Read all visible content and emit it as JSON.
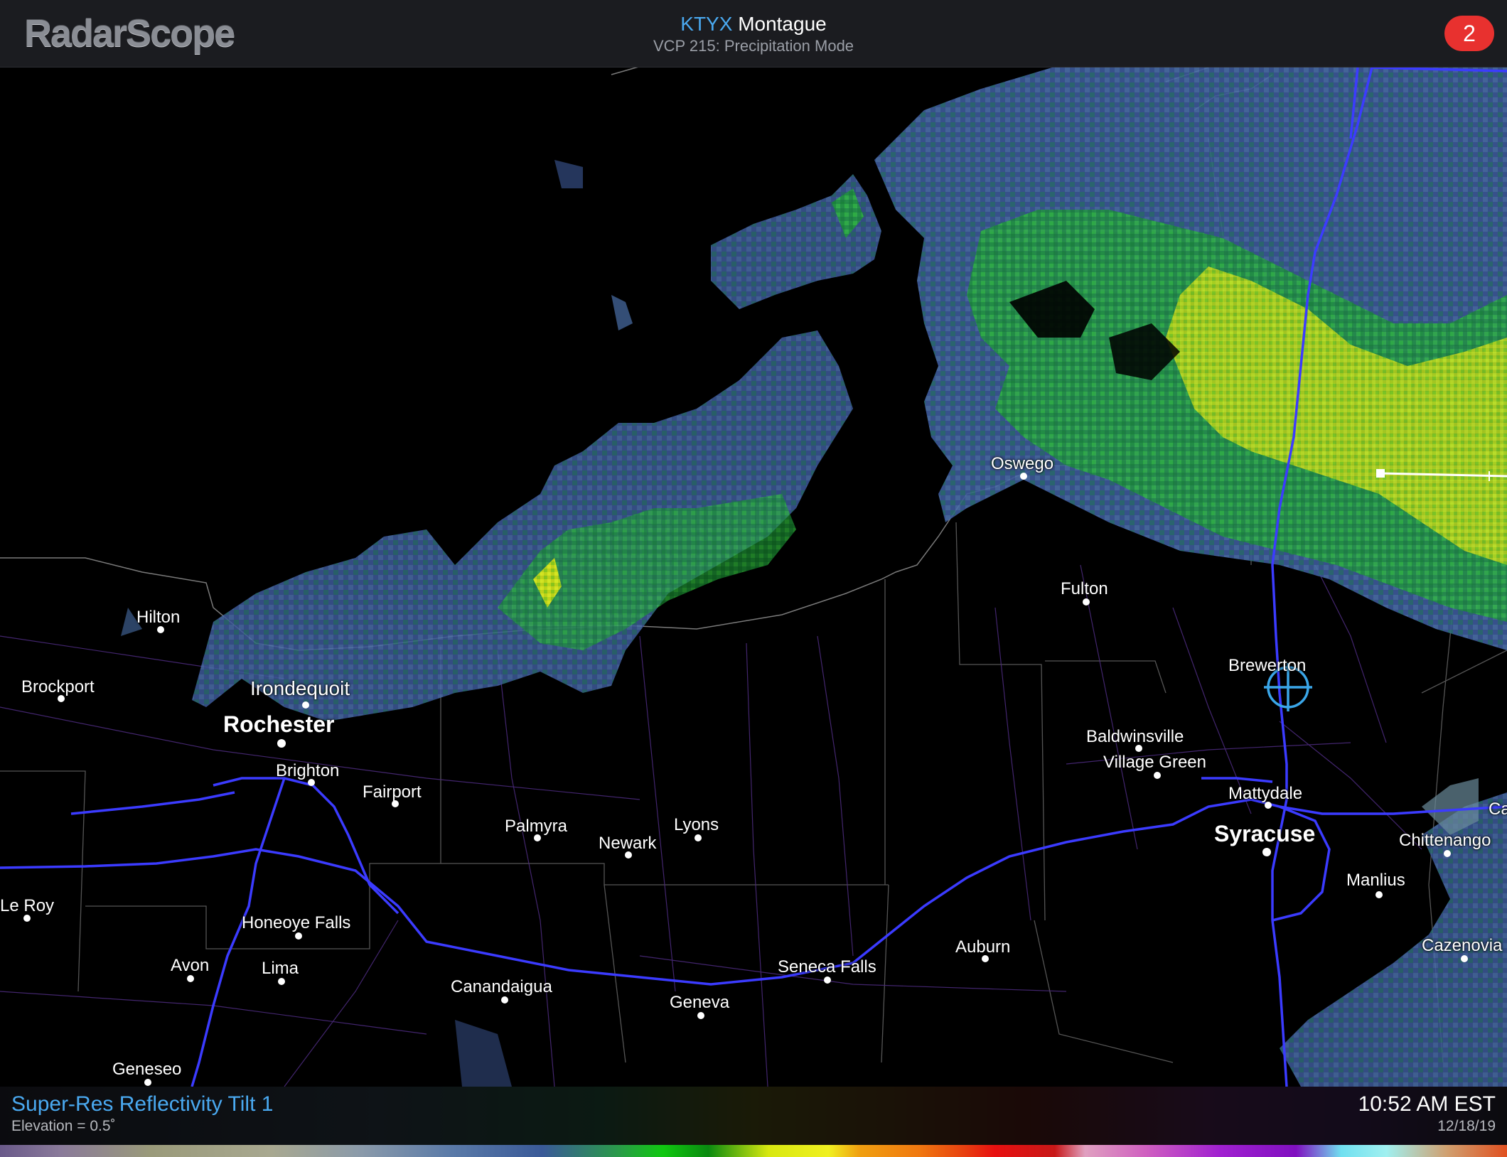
{
  "app": {
    "logo_text": "RadarScope"
  },
  "header": {
    "station_id": "KTYX",
    "station_name": "Montague",
    "vcp": "VCP 215: Precipitation Mode",
    "alert_count": "2"
  },
  "map": {
    "cities": [
      {
        "name": "Oswego",
        "size": "small"
      },
      {
        "name": "Fulton",
        "size": "small"
      },
      {
        "name": "Hilton",
        "size": "small"
      },
      {
        "name": "Brockport",
        "size": "small"
      },
      {
        "name": "Irondequoit",
        "size": "medium"
      },
      {
        "name": "Rochester",
        "size": "large"
      },
      {
        "name": "Brighton",
        "size": "small"
      },
      {
        "name": "Fairport",
        "size": "small"
      },
      {
        "name": "Palmyra",
        "size": "small"
      },
      {
        "name": "Newark",
        "size": "small"
      },
      {
        "name": "Lyons",
        "size": "small"
      },
      {
        "name": "Brewerton",
        "size": "small"
      },
      {
        "name": "Baldwinsville",
        "size": "small"
      },
      {
        "name": "Village Green",
        "size": "small"
      },
      {
        "name": "Mattydale",
        "size": "small"
      },
      {
        "name": "Syracuse",
        "size": "large"
      },
      {
        "name": "Chittenango",
        "size": "small"
      },
      {
        "name": "Manlius",
        "size": "small"
      },
      {
        "name": "Cazenovia",
        "size": "small"
      },
      {
        "name": "Le Roy",
        "size": "small"
      },
      {
        "name": "Honeoye Falls",
        "size": "small"
      },
      {
        "name": "Avon",
        "size": "small"
      },
      {
        "name": "Lima",
        "size": "small"
      },
      {
        "name": "Canandaigua",
        "size": "small"
      },
      {
        "name": "Geneva",
        "size": "small"
      },
      {
        "name": "Seneca Falls",
        "size": "small"
      },
      {
        "name": "Auburn",
        "size": "small"
      },
      {
        "name": "Geneseo",
        "size": "small"
      },
      {
        "name": "Ca",
        "size": "small"
      }
    ],
    "icons": {
      "location_marker": "crosshair-location-icon",
      "measure_tool": "distance-ruler-icon"
    }
  },
  "footer": {
    "product": "Super-Res Reflectivity Tilt 1",
    "elevation": "Elevation = 0.5˚",
    "time": "10:52 AM EST",
    "date": "12/18/19"
  },
  "colors": {
    "accent_blue": "#4aa9f0",
    "header_bg": "#1b1c20",
    "alert_red": "#e8312f",
    "highway_blue": "#3b3bff"
  }
}
